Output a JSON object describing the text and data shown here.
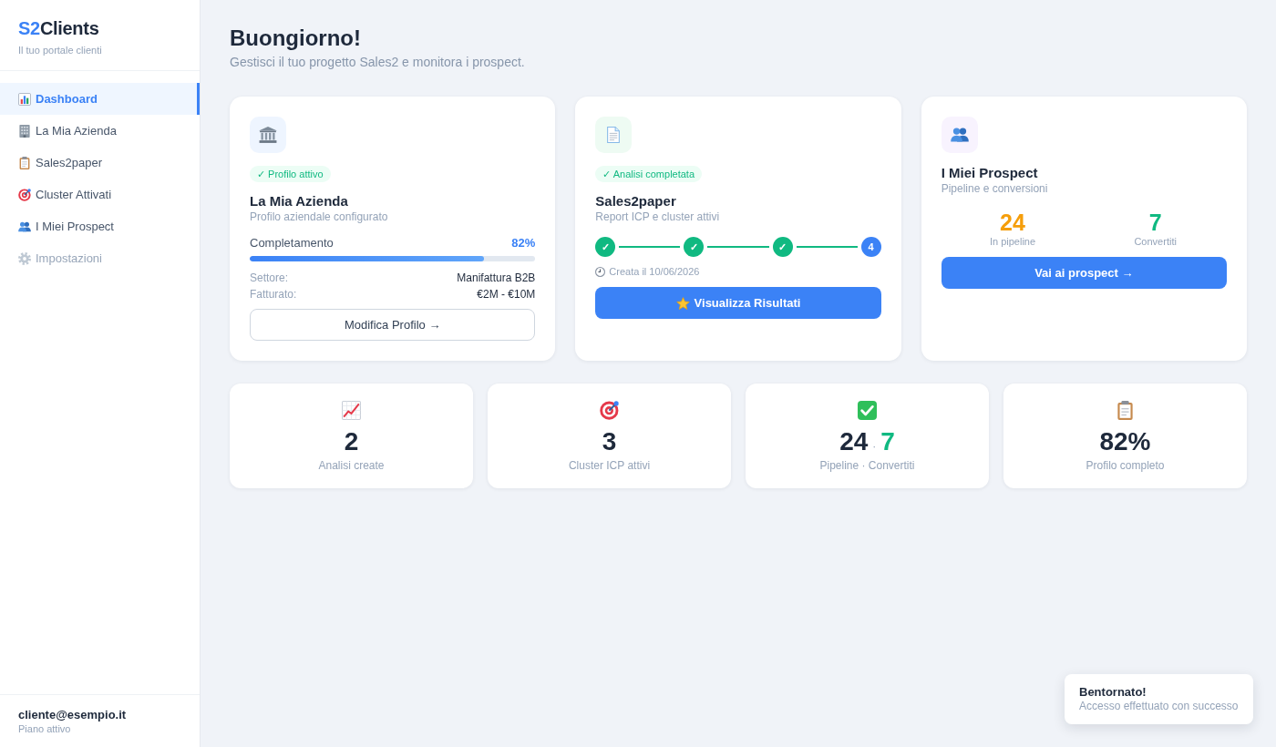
{
  "sidebar": {
    "logo": {
      "accent": "S2",
      "text": "Clients"
    },
    "tagline": "Il tuo portale clienti",
    "items": [
      {
        "label": "Dashboard",
        "selected": true,
        "disabled": false
      },
      {
        "label": "La Mia Azienda",
        "selected": false,
        "disabled": false
      },
      {
        "label": "Sales2paper",
        "selected": false,
        "disabled": false
      },
      {
        "label": "Cluster Attivati",
        "selected": false,
        "disabled": false
      },
      {
        "label": "I Miei Prospect",
        "selected": false,
        "disabled": false
      },
      {
        "label": "Impostazioni",
        "selected": false,
        "disabled": true
      }
    ],
    "user": {
      "email": "cliente@esempio.it",
      "plan": "Piano attivo"
    }
  },
  "header": {
    "title": "Buongiorno!",
    "subtitle": "Gestisci il tuo progetto Sales2 e monitora i prospect."
  },
  "cards": [
    {
      "kind": "profile",
      "badge": "✓ Profilo attivo",
      "title": "La Mia Azienda",
      "subtitle": "Profilo aziendale configurato",
      "progress": {
        "label": "Completamento",
        "reading": "82%",
        "level": 0.82
      },
      "details": [
        {
          "label": "Settore:",
          "value": "Manifattura B2B"
        },
        {
          "label": "Fatturato:",
          "value": "€2M - €10M"
        }
      ],
      "button": {
        "label": "Modifica Profilo →",
        "kind": "outline"
      }
    },
    {
      "kind": "report",
      "badge": "✓ Analisi completata",
      "title": "Sales2paper",
      "subtitle": "Report ICP e cluster attivi",
      "steps": [
        {
          "label": "✓",
          "done": true
        },
        {
          "label": "✓",
          "done": true
        },
        {
          "label": "✓",
          "done": true
        },
        {
          "label": "4",
          "done": false
        }
      ],
      "date": "Creata il 10/06/2026",
      "button": {
        "label": "Visualizza Risultati",
        "kind": "primary"
      }
    },
    {
      "kind": "prospects",
      "title": "I Miei Prospect",
      "subtitle": "Pipeline e conversioni",
      "stats": [
        {
          "value": "24",
          "label": "In pipeline",
          "color": "#f59e0b"
        },
        {
          "value": "7",
          "label": "Convertiti",
          "color": "#10b981"
        }
      ],
      "button": {
        "label": "Vai ai prospect →",
        "kind": "primary"
      }
    }
  ],
  "stats": [
    {
      "kind": "single",
      "value": "2",
      "label": "Analisi create"
    },
    {
      "kind": "single",
      "value": "3",
      "label": "Cluster ICP attivi"
    },
    {
      "kind": "pair",
      "value": "24",
      "separator": "·",
      "second_value": "7",
      "label": "Pipeline · Convertiti"
    },
    {
      "kind": "single",
      "value": "82%",
      "label": "Profilo completo"
    }
  ],
  "toast": {
    "title": "Bentornato!",
    "message": "Accesso effettuato con successo"
  }
}
